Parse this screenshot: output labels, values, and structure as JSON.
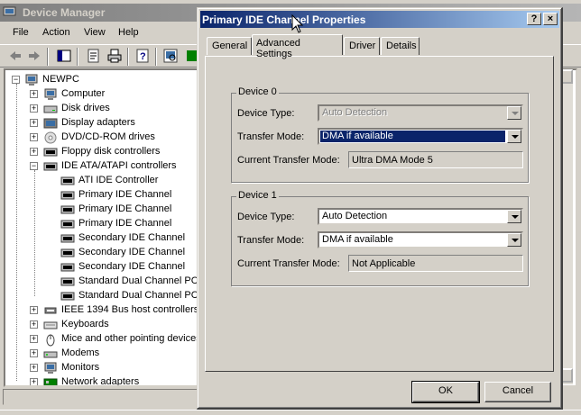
{
  "device_manager": {
    "title": "Device Manager",
    "menu": [
      "File",
      "Action",
      "View",
      "Help"
    ],
    "toolbar_icons": [
      "back-icon",
      "forward-icon",
      "show-hide-tree-icon",
      "properties-icon",
      "print-icon",
      "help-icon",
      "scan-hardware-icon",
      "update-driver-icon"
    ],
    "tree": {
      "root": "NEWPC",
      "categories": [
        {
          "label": "Computer",
          "icon": "computer-icon",
          "expanded": false
        },
        {
          "label": "Disk drives",
          "icon": "disk-drive-icon",
          "expanded": false
        },
        {
          "label": "Display adapters",
          "icon": "display-adapter-icon",
          "expanded": false
        },
        {
          "label": "DVD/CD-ROM drives",
          "icon": "cdrom-icon",
          "expanded": false
        },
        {
          "label": "Floppy disk controllers",
          "icon": "controller-icon",
          "expanded": false
        },
        {
          "label": "IDE ATA/ATAPI controllers",
          "icon": "controller-icon",
          "expanded": true
        }
      ],
      "ide_children": [
        "ATI IDE Controller",
        "Primary IDE Channel",
        "Primary IDE Channel",
        "Primary IDE Channel",
        "Secondary IDE Channel",
        "Secondary IDE Channel",
        "Secondary IDE Channel",
        "Standard Dual Channel PCI",
        "Standard Dual Channel PCI"
      ],
      "more_categories": [
        {
          "label": "IEEE 1394 Bus host controllers",
          "icon": "firewire-icon"
        },
        {
          "label": "Keyboards",
          "icon": "keyboard-icon"
        },
        {
          "label": "Mice and other pointing devices",
          "icon": "mouse-icon"
        },
        {
          "label": "Modems",
          "icon": "modem-icon"
        },
        {
          "label": "Monitors",
          "icon": "monitor-icon"
        },
        {
          "label": "Network adapters",
          "icon": "network-adapter-icon"
        }
      ]
    }
  },
  "dialog": {
    "title": "Primary IDE Channel Properties",
    "caption_buttons": {
      "help": "?",
      "close": "×"
    },
    "tabs": [
      {
        "label": "General",
        "active": false
      },
      {
        "label": "Advanced Settings",
        "active": true
      },
      {
        "label": "Driver",
        "active": false
      },
      {
        "label": "Details",
        "active": false
      }
    ],
    "device0": {
      "legend": "Device 0",
      "device_type_label": "Device Type:",
      "device_type_value": "Auto Detection",
      "device_type_enabled": false,
      "transfer_mode_label": "Transfer Mode:",
      "transfer_mode_value": "DMA if available",
      "current_mode_label": "Current Transfer Mode:",
      "current_mode_value": "Ultra DMA Mode 5"
    },
    "device1": {
      "legend": "Device 1",
      "device_type_label": "Device Type:",
      "device_type_value": "Auto Detection",
      "transfer_mode_label": "Transfer Mode:",
      "transfer_mode_value": "DMA if available",
      "current_mode_label": "Current Transfer Mode:",
      "current_mode_value": "Not Applicable"
    },
    "buttons": {
      "ok": "OK",
      "cancel": "Cancel"
    }
  },
  "colors": {
    "active_title_start": "#0a246a",
    "active_title_end": "#a6caf0",
    "inactive_title": "#808080",
    "face": "#d4d0c8",
    "desktop": "#3a6ea5"
  }
}
